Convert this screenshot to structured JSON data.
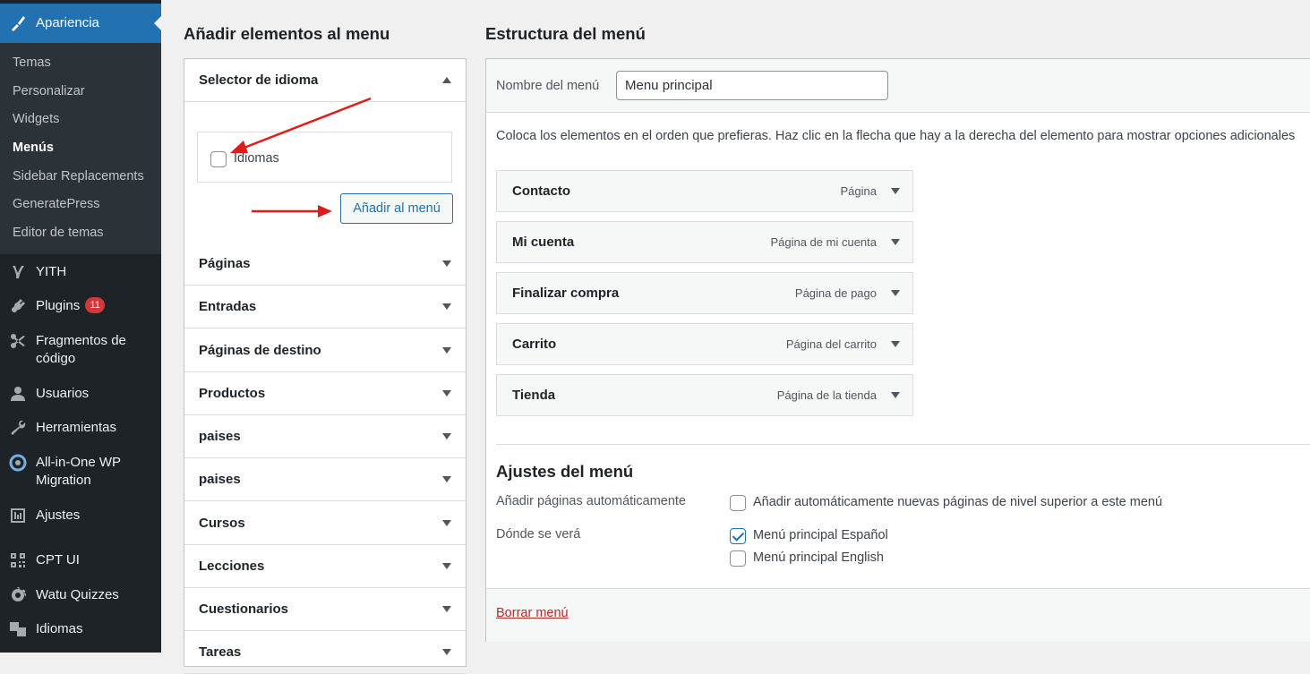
{
  "sidebar": {
    "current": {
      "label": "Apariencia",
      "icon": "paintbrush-icon"
    },
    "submenu": [
      {
        "label": "Temas"
      },
      {
        "label": "Personalizar"
      },
      {
        "label": "Widgets"
      },
      {
        "label": "Menús",
        "current": true
      },
      {
        "label": "Sidebar Replacements"
      },
      {
        "label": "GeneratePress"
      },
      {
        "label": "Editor de temas"
      }
    ],
    "items": [
      {
        "label": "YITH",
        "icon": "yith-icon"
      },
      {
        "label": "Plugins",
        "icon": "plugin-icon",
        "badge": "11"
      },
      {
        "label": "Fragmentos de código",
        "icon": "scissors-icon"
      },
      {
        "label": "Usuarios",
        "icon": "user-icon"
      },
      {
        "label": "Herramientas",
        "icon": "wrench-icon"
      },
      {
        "label": "All-in-One WP Migration",
        "icon": "migration-icon"
      },
      {
        "label": "Ajustes",
        "icon": "settings-icon"
      },
      {
        "label": "CPT UI",
        "icon": "cpt-icon"
      },
      {
        "label": "Watu Quizzes",
        "icon": "gear-icon"
      },
      {
        "label": "Idiomas",
        "icon": "translation-icon"
      }
    ]
  },
  "add_items": {
    "title": "Añadir elementos al menu",
    "selector": {
      "title": "Selector de idioma",
      "option_label": "Idiomas",
      "button_label": "Añadir al menú"
    },
    "sections": [
      "Páginas",
      "Entradas",
      "Páginas de destino",
      "Productos",
      "paises",
      "paises",
      "Cursos",
      "Lecciones",
      "Cuestionarios",
      "Tareas"
    ]
  },
  "structure": {
    "title": "Estructura del menú",
    "name_label": "Nombre del menú",
    "name_value": "Menu principal",
    "instructions": "Coloca los elementos en el orden que prefieras. Haz clic en la flecha que hay a la derecha del elemento para mostrar opciones adicionales",
    "items": [
      {
        "title": "Contacto",
        "type": "Página"
      },
      {
        "title": "Mi cuenta",
        "type": "Página de mi cuenta"
      },
      {
        "title": "Finalizar compra",
        "type": "Página de pago"
      },
      {
        "title": "Carrito",
        "type": "Página del carrito"
      },
      {
        "title": "Tienda",
        "type": "Página de la tienda"
      }
    ],
    "settings": {
      "title": "Ajustes del menú",
      "auto_add_label": "Añadir páginas automáticamente",
      "auto_add_option": "Añadir automáticamente nuevas páginas de nivel superior a este menú",
      "locations_label": "Dónde se verá",
      "locations": [
        {
          "label": "Menú principal Español",
          "checked": true
        },
        {
          "label": "Menú principal English",
          "checked": false
        }
      ]
    },
    "delete_label": "Borrar menú"
  },
  "colors": {
    "accent": "#2271b1",
    "sidebar": "#1d2327",
    "annotation_arrow": "#e01b1b"
  }
}
